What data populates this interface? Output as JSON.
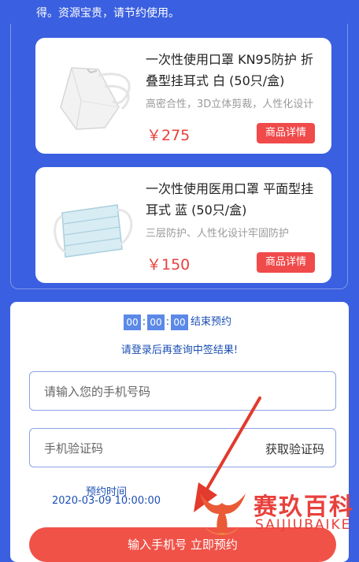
{
  "notice": "得。资源宝贵，请节约使用。",
  "products": [
    {
      "title": "一次性使用口罩 KN95防护 折叠型挂耳式 白 (50只/盒)",
      "desc": "高密合性，3D立体剪裁，人性化设计",
      "price": "￥275",
      "button": "商品详情",
      "image_icon": "kn95-mask-image"
    },
    {
      "title": "一次性使用医用口罩 平面型挂耳式 蓝 (50只/盒)",
      "desc": "三层防护、人性化设计牢固防护",
      "price": "￥150",
      "button": "商品详情",
      "image_icon": "medical-mask-image"
    }
  ],
  "timer": {
    "h": "00",
    "m": "00",
    "s": "00",
    "sep": ":",
    "end_label": "结束预约"
  },
  "hint": "请登录后再查询中签结果!",
  "phone_placeholder": "请输入您的手机号码",
  "code_placeholder": "手机验证码",
  "get_code": "获取验证码",
  "reserve_label": "预约时间",
  "reserve_time": "2020-03-09 10:00:00",
  "submit": "输入手机号 立即预约",
  "watermark": {
    "cn": "赛玖百科",
    "en": "SAIJIUBAIKE"
  },
  "colors": {
    "background": "#3a5fe0",
    "accent_red": "#f04a4a",
    "link_blue": "#1b4fb3"
  }
}
